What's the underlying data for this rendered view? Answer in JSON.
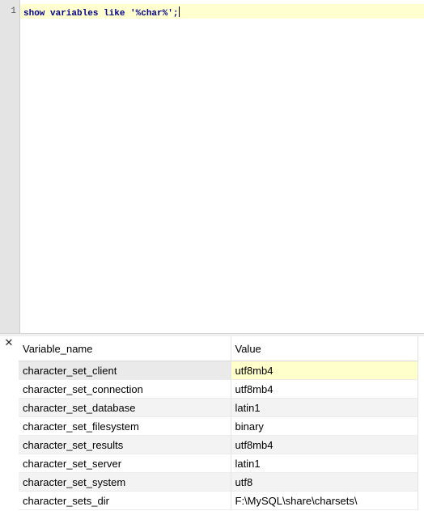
{
  "editor": {
    "line_number": "1",
    "code": "show variables like '%char%';"
  },
  "results": {
    "close_glyph": "✕",
    "columns": [
      "Variable_name",
      "Value"
    ],
    "rows": [
      [
        "character_set_client",
        "utf8mb4"
      ],
      [
        "character_set_connection",
        "utf8mb4"
      ],
      [
        "character_set_database",
        "latin1"
      ],
      [
        "character_set_filesystem",
        "binary"
      ],
      [
        "character_set_results",
        "utf8mb4"
      ],
      [
        "character_set_server",
        "latin1"
      ],
      [
        "character_set_system",
        "utf8"
      ],
      [
        "character_sets_dir",
        "F:\\MySQL\\share\\charsets\\"
      ]
    ],
    "selected_row": 0,
    "active_cell_color": "#ffffcc"
  }
}
